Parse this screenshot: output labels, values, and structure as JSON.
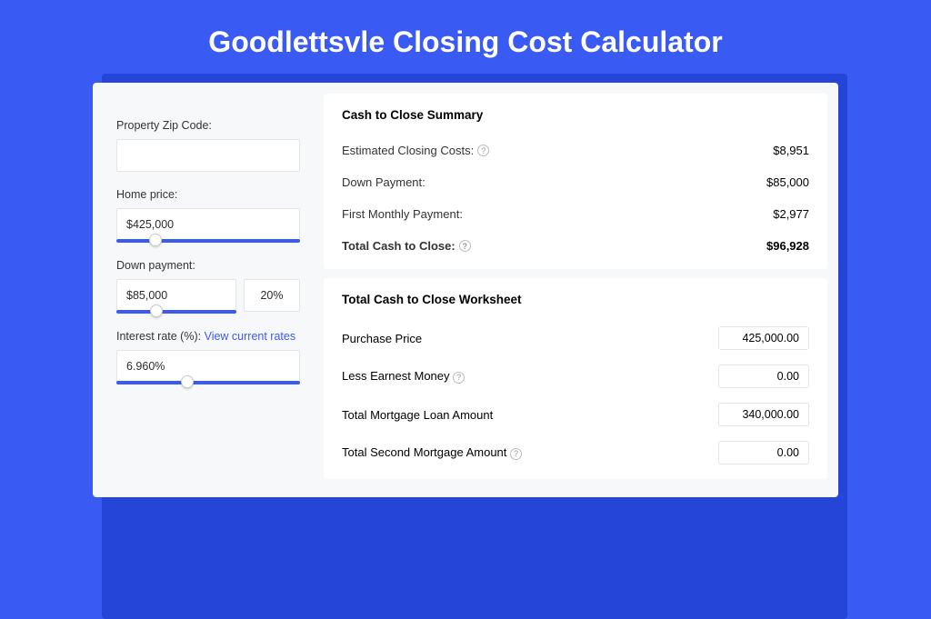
{
  "title": "Goodlettsvle Closing Cost Calculator",
  "sidebar": {
    "zip": {
      "label": "Property Zip Code:",
      "value": ""
    },
    "price": {
      "label": "Home price:",
      "value": "$425,000",
      "slider_pct": 18
    },
    "down": {
      "label": "Down payment:",
      "value": "$85,000",
      "pct": "20%",
      "slider_pct": 28
    },
    "rate": {
      "label": "Interest rate (%):",
      "link": "View current rates",
      "value": "6.960%",
      "slider_pct": 35
    }
  },
  "summary": {
    "header": "Cash to Close Summary",
    "rows": [
      {
        "k": "Estimated Closing Costs:",
        "help": true,
        "v": "$8,951",
        "bold": false
      },
      {
        "k": "Down Payment:",
        "help": false,
        "v": "$85,000",
        "bold": false
      },
      {
        "k": "First Monthly Payment:",
        "help": false,
        "v": "$2,977",
        "bold": false
      },
      {
        "k": "Total Cash to Close:",
        "help": true,
        "v": "$96,928",
        "bold": true
      }
    ]
  },
  "worksheet": {
    "header": "Total Cash to Close Worksheet",
    "rows": [
      {
        "k": "Purchase Price",
        "help": false,
        "v": "425,000.00"
      },
      {
        "k": "Less Earnest Money",
        "help": true,
        "v": "0.00"
      },
      {
        "k": "Total Mortgage Loan Amount",
        "help": false,
        "v": "340,000.00"
      },
      {
        "k": "Total Second Mortgage Amount",
        "help": true,
        "v": "0.00"
      }
    ]
  }
}
